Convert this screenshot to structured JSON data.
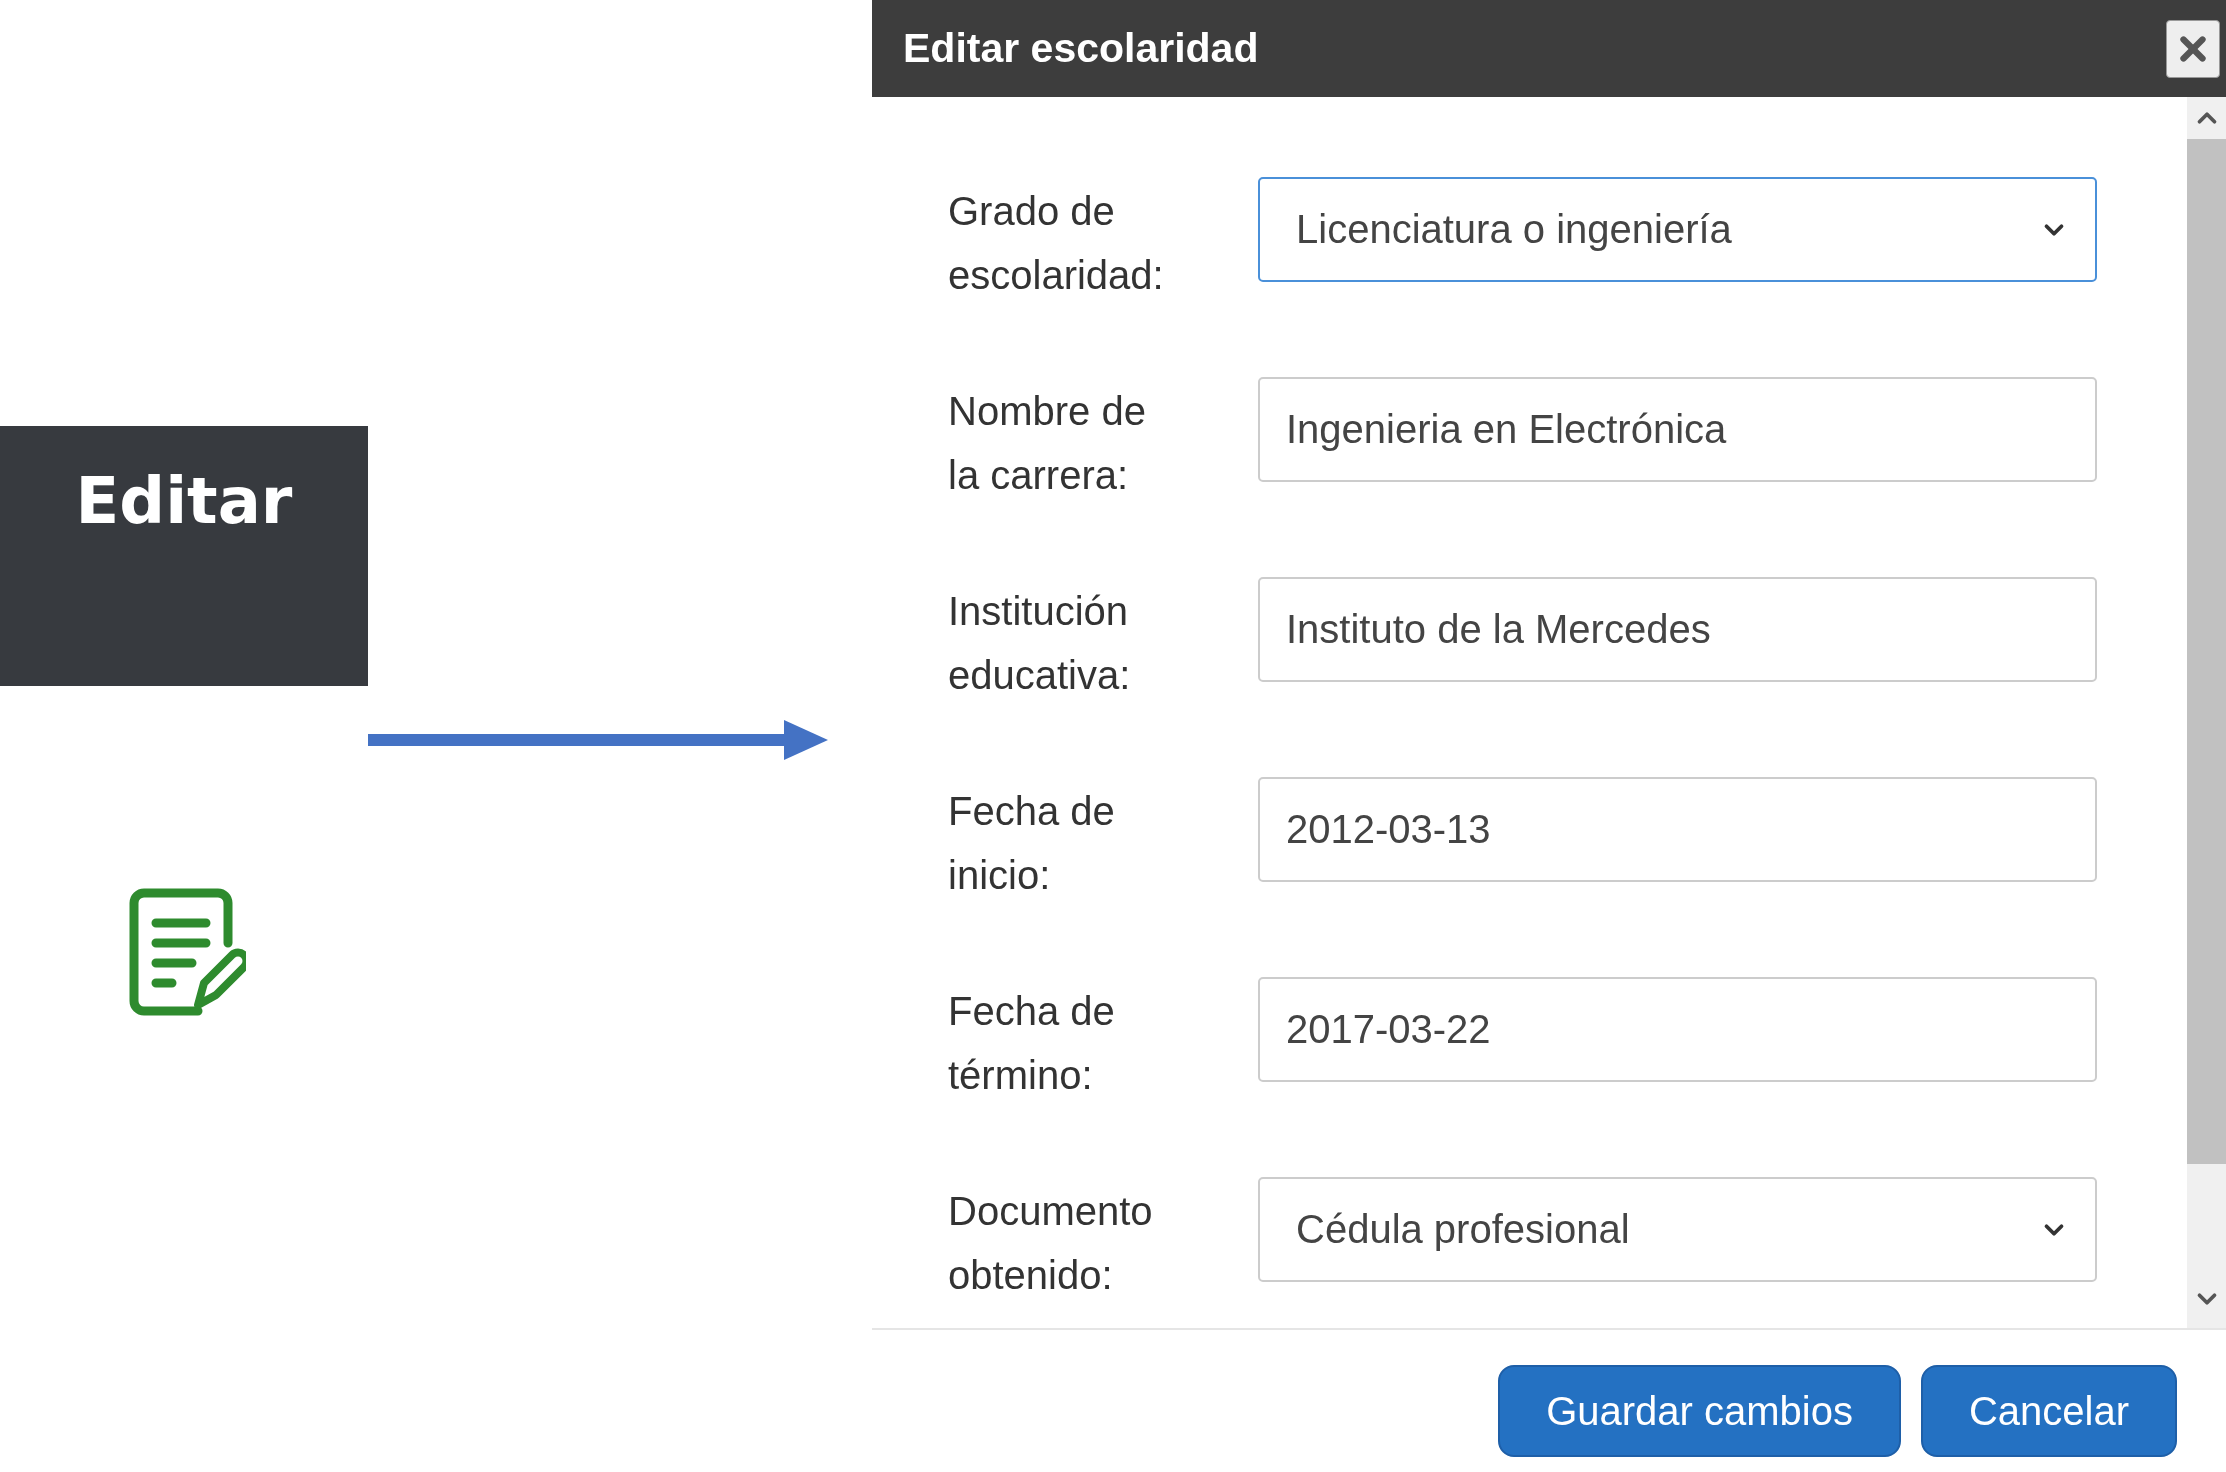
{
  "callout": {
    "label": "Editar"
  },
  "dialog": {
    "title": "Editar escolaridad",
    "fields": [
      {
        "kind": "select",
        "label": "Grado de escolaridad:",
        "value": "Licenciatura o ingeniería",
        "focused": true
      },
      {
        "kind": "text",
        "label": "Nombre de la carrera:",
        "value": "Ingenieria en Electrónica",
        "focused": false
      },
      {
        "kind": "text",
        "label": "Institución educativa:",
        "value": "Instituto de la Mercedes",
        "focused": false
      },
      {
        "kind": "text",
        "label": "Fecha de inicio:",
        "value": "2012-03-13",
        "focused": false
      },
      {
        "kind": "text",
        "label": "Fecha de término:",
        "value": "2017-03-22",
        "focused": false
      },
      {
        "kind": "select",
        "label": "Documento obtenido:",
        "value": "Cédula profesional",
        "focused": false
      }
    ],
    "buttons": [
      "Guardar cambios",
      "Cancelar"
    ]
  }
}
